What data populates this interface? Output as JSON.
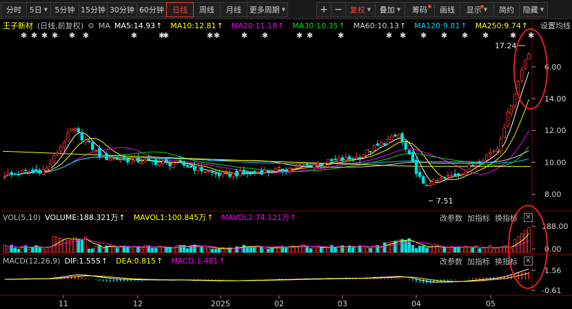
{
  "toolbar": {
    "periods": [
      "分时",
      "5日",
      "5分钟",
      "15分钟",
      "30分钟",
      "60分钟",
      "日线",
      "周线",
      "月线",
      "更多周期"
    ],
    "active_period": "日线",
    "add": "+",
    "minus": "−",
    "fq": "复权",
    "overlay": "叠加",
    "chips": "筹码",
    "draw": "画线",
    "display": "显示",
    "simple": "简约",
    "hide": "隐藏",
    "caret": "▼"
  },
  "main": {
    "stock": "王子新材",
    "mode": "(日线,前复权)",
    "ma": "MA",
    "ma_items": [
      {
        "label": "MA5:14.93",
        "color": "#ffffff"
      },
      {
        "label": "MA10:12.81",
        "color": "#ffff00"
      },
      {
        "label": "MA20:11.18",
        "color": "#ff00ff"
      },
      {
        "label": "MA30:10.35",
        "color": "#00e000"
      },
      {
        "label": "MA60:10.13",
        "color": "#d0d0d0"
      },
      {
        "label": "MA120:9.81",
        "color": "#00d0ff"
      },
      {
        "label": "MA250:9.74",
        "color": "#ffff00"
      }
    ],
    "settings": "设置均线",
    "high_label": "17.24",
    "low_label": "7.51",
    "y_ticks": [
      "6.00",
      "14.00",
      "12.00",
      "10.00",
      "8.00"
    ]
  },
  "vol": {
    "title": "VOL(5,10)",
    "items": [
      {
        "label": "VOLUME:188.321万",
        "color": "#ffffff"
      },
      {
        "label": "MAVOL1:100.845万",
        "color": "#ffff00"
      },
      {
        "label": "MAVOL2:74.121万",
        "color": "#ff00ff"
      }
    ],
    "y_ticks": [
      "188.00",
      "0.00"
    ],
    "params": "改参数",
    "add_ind": "加指标",
    "switch_ind": "换指标",
    "close": "✕"
  },
  "macd": {
    "title": "MACD(12,26,9)",
    "items": [
      {
        "label": "DIF:1.555",
        "color": "#ffffff"
      },
      {
        "label": "DEA:0.815",
        "color": "#ffff00"
      },
      {
        "label": "MACD:1.481",
        "color": "#ff00ff"
      }
    ],
    "y_ticks": [
      "1.56",
      "-0.61"
    ],
    "params": "改参数",
    "add_ind": "加指标",
    "switch_ind": "换指标",
    "close": "✕"
  },
  "x_axis": [
    "11",
    "12",
    "2025",
    "02",
    "03",
    "04",
    "05"
  ],
  "colors": {
    "up": "#ff3b30",
    "down": "#00e0e0",
    "annot": "#e82020"
  }
}
